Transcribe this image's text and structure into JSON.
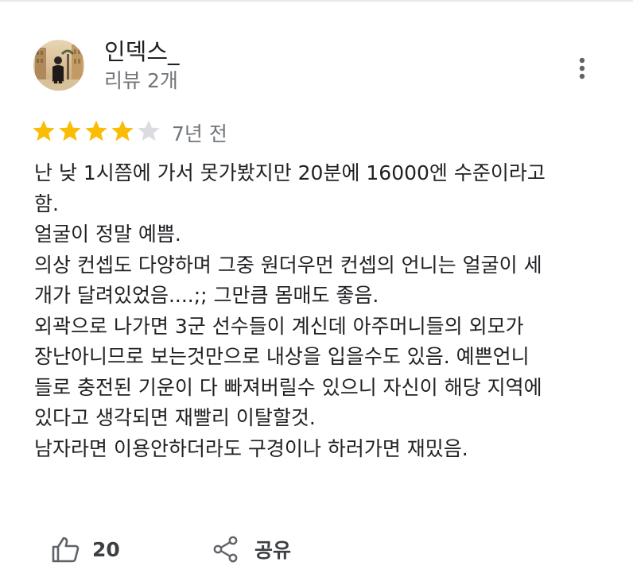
{
  "author": {
    "name": "인덱스_",
    "meta": "리뷰 2개"
  },
  "review": {
    "rating": 4,
    "rating_max": 5,
    "date": "7년 전",
    "lines": [
      "난 낮 1시쯤에 가서 못가봤지만 20분에 16000엔 수준이라고",
      "함.",
      "얼굴이 정말 예쁨.",
      "의상 컨셉도 다양하며 그중 원더우먼 컨셉의 언니는 얼굴이 세",
      "개가 달려있었음....;; 그만큼 몸매도 좋음.",
      "외곽으로 나가면 3군 선수들이 계신데 아주머니들의 외모가",
      "장난아니므로 보는것만으로 내상을 입을수도 있음. 예쁜언니",
      "들로 충전된 기운이 다 빠져버릴수 있으니 자신이 해당 지역에",
      "있다고 생각되면 재빨리 이탈할것.",
      "남자라면 이용안하더라도 구경이나 하러가면 재밌음."
    ]
  },
  "actions": {
    "like_count": "20",
    "share_label": "공유"
  },
  "icons": {
    "more": "more-vertical-icon",
    "star": "star-icon",
    "like": "thumbs-up-icon",
    "share": "share-icon"
  },
  "colors": {
    "star_filled": "#fbbc04",
    "star_empty": "#dadce0",
    "text_primary": "#202124",
    "text_secondary": "#70757a",
    "icon": "#5f6368"
  }
}
